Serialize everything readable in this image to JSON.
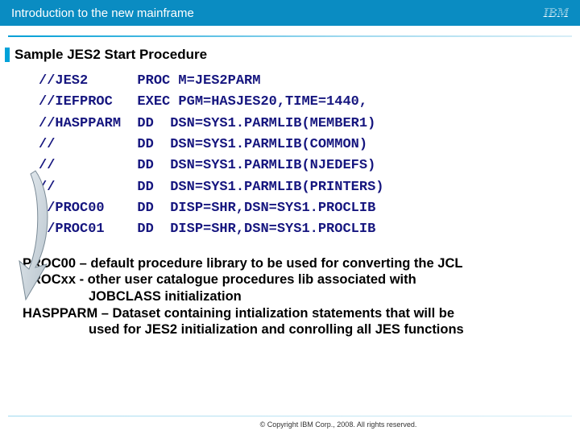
{
  "header": {
    "title": "Introduction to the new mainframe",
    "logo_text": "IBM"
  },
  "slide": {
    "title": "Sample JES2 Start Procedure"
  },
  "code": {
    "lines": [
      "//JES2      PROC M=JES2PARM",
      "//IEFPROC   EXEC PGM=HASJES20,TIME=1440,",
      "//HASPPARM  DD  DSN=SYS1.PARMLIB(MEMBER1)",
      "//          DD  DSN=SYS1.PARMLIB(COMMON)",
      "//          DD  DSN=SYS1.PARMLIB(NJEDEFS)",
      "//          DD  DSN=SYS1.PARMLIB(PRINTERS)",
      "//PROC00    DD  DISP=SHR,DSN=SYS1.PROCLIB",
      "//PROC01    DD  DISP=SHR,DSN=SYS1.PROCLIB"
    ]
  },
  "notes": {
    "l1": "PROC00  – default procedure library to be used for converting the JCL",
    "l2": "PROCxx  -  other user catalogue procedures lib associated with",
    "l2b": "JOBCLASS initialization",
    "l3": "HASPPARM – Dataset containing intialization statements that will be",
    "l3b": "used for JES2 initialization and conrolling all JES functions"
  },
  "footer": {
    "copyright": "© Copyright IBM Corp., 2008. All rights reserved."
  }
}
